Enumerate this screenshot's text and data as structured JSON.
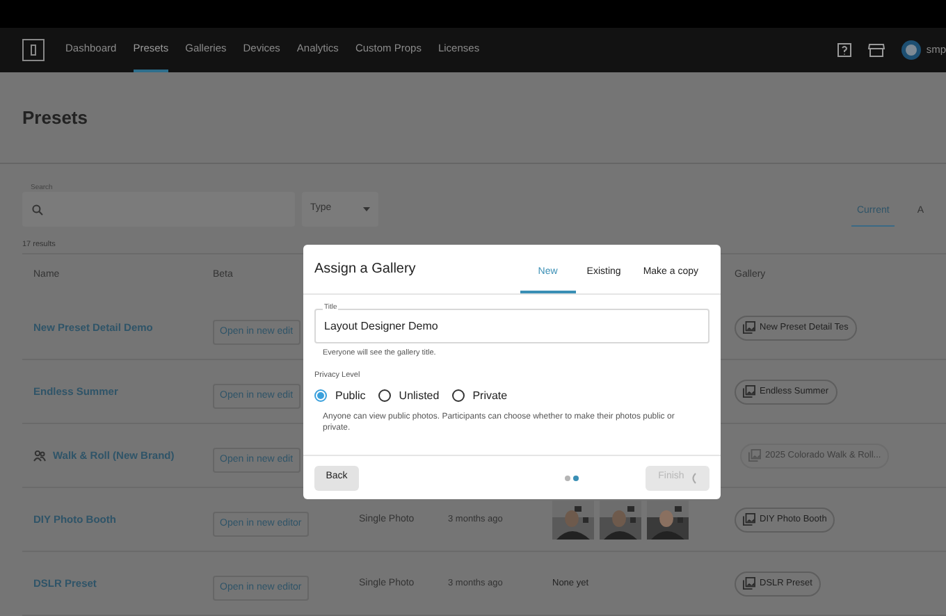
{
  "nav": {
    "items": [
      {
        "label": "Dashboard",
        "selected": false
      },
      {
        "label": "Presets",
        "selected": true
      },
      {
        "label": "Galleries",
        "selected": false
      },
      {
        "label": "Devices",
        "selected": false
      },
      {
        "label": "Analytics",
        "selected": false
      },
      {
        "label": "Custom Props",
        "selected": false
      },
      {
        "label": "Licenses",
        "selected": false
      }
    ],
    "user": "smp"
  },
  "page_title": "Presets",
  "search": {
    "label": "Search"
  },
  "type_filter": {
    "label": "Type"
  },
  "results": "17 results",
  "view_tabs": [
    {
      "label": "Current",
      "selected": true
    },
    {
      "label": "A",
      "selected": false
    }
  ],
  "table": {
    "columns": [
      "Name",
      "Beta",
      "Gallery"
    ],
    "rows": [
      {
        "name": "New Preset Detail Demo",
        "shared": false,
        "beta": "Open in new edit",
        "gallery": "New Preset Detail Tes",
        "gallery_disabled": false
      },
      {
        "name": "Endless Summer",
        "shared": false,
        "beta": "Open in new edit",
        "gallery": "Endless Summer",
        "gallery_disabled": false
      },
      {
        "name": "Walk & Roll (New Brand)",
        "shared": true,
        "beta": "Open in new edit",
        "gallery": "2025 Colorado Walk & Roll...",
        "gallery_disabled": true
      },
      {
        "name": "DIY Photo Booth",
        "shared": false,
        "beta": "Open in new editor",
        "type": "Single Photo",
        "updated": "3 months ago",
        "preview": {
          "kind": "photos"
        },
        "gallery": "DIY Photo Booth",
        "gallery_disabled": false
      },
      {
        "name": "DSLR Preset",
        "shared": false,
        "beta": "Open in new editor",
        "type": "Single Photo",
        "updated": "3 months ago",
        "preview": {
          "kind": "text",
          "text": "None yet"
        },
        "gallery": "DSLR Preset",
        "gallery_disabled": false
      }
    ]
  },
  "dialog": {
    "title": "Assign a Gallery",
    "tabs": [
      {
        "label": "New",
        "selected": true
      },
      {
        "label": "Existing",
        "selected": false
      },
      {
        "label": "Make a copy",
        "selected": false
      }
    ],
    "title_field": {
      "label": "Title",
      "value": "Layout Designer Demo",
      "helper": "Everyone will see the gallery title."
    },
    "privacy": {
      "label": "Privacy Level",
      "options": [
        {
          "label": "Public",
          "selected": true
        },
        {
          "label": "Unlisted",
          "selected": false
        },
        {
          "label": "Private",
          "selected": false
        }
      ],
      "description": "Anyone can view public photos. Participants can choose whether to make their photos public or private."
    },
    "back": "Back",
    "steps": [
      {
        "selected": false
      },
      {
        "selected": true
      }
    ],
    "finish": {
      "label": "Finish",
      "disabled": true,
      "loading": true
    }
  }
}
